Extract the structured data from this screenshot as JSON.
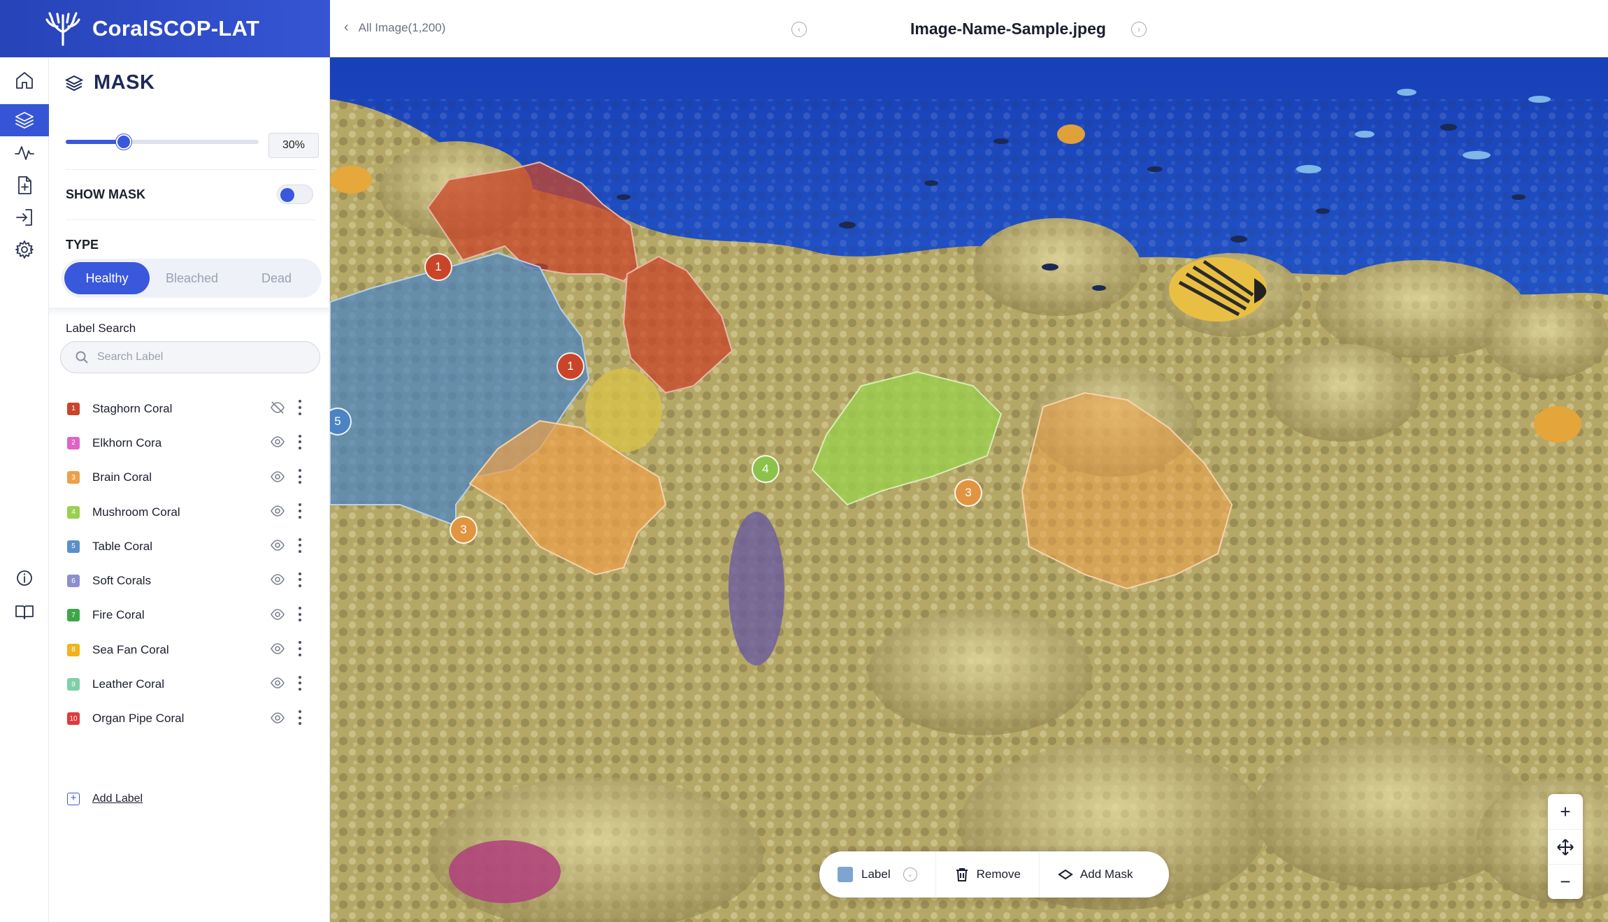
{
  "app": {
    "name": "CoralSCOP-LAT"
  },
  "topbar": {
    "back_label": "All Image(1,200)",
    "image_name": "Image-Name-Sample.jpeg"
  },
  "panel": {
    "title": "MASK",
    "opacity_value": "30%",
    "opacity_fraction": 0.3,
    "show_mask_label": "SHOW MASK",
    "show_mask_on": true,
    "type_label": "TYPE",
    "types": [
      "Healthy",
      "Bleached",
      "Dead"
    ],
    "active_type": "Healthy",
    "label_search_label": "Label Search",
    "search_placeholder": "Search Label",
    "labels": [
      {
        "num": "1",
        "name": "Staghorn Coral",
        "color": "#c9452a",
        "hidden": true
      },
      {
        "num": "2",
        "name": "Elkhorn Cora",
        "color": "#e063c8",
        "hidden": false
      },
      {
        "num": "3",
        "name": "Brain Coral",
        "color": "#eca04a",
        "hidden": false
      },
      {
        "num": "4",
        "name": "Mushroom Coral",
        "color": "#9bd04e",
        "hidden": false
      },
      {
        "num": "5",
        "name": "Table Coral",
        "color": "#5b8fc8",
        "hidden": false
      },
      {
        "num": "6",
        "name": "Soft Corals",
        "color": "#8b8fcf",
        "hidden": false
      },
      {
        "num": "7",
        "name": "Fire Coral",
        "color": "#3fa648",
        "hidden": false
      },
      {
        "num": "8",
        "name": "Sea Fan Coral",
        "color": "#f2b21c",
        "hidden": false
      },
      {
        "num": "9",
        "name": "Leather Coral",
        "color": "#7fcfa7",
        "hidden": false
      },
      {
        "num": "10",
        "name": "Organ Pipe Coral",
        "color": "#e03b3b",
        "hidden": false
      }
    ],
    "add_label": "Add Label"
  },
  "canvas": {
    "markers": [
      "1",
      "1",
      "5",
      "4",
      "3",
      "3"
    ]
  },
  "toolbar": {
    "label": "Label",
    "remove": "Remove",
    "add_mask": "Add Mask"
  },
  "colors": {
    "accent": "#3a58dc",
    "brand": "#2f4dc9"
  },
  "icons": {
    "rail": [
      "home-icon",
      "grid-icon",
      "layers-icon",
      "activity-icon",
      "file-plus-icon",
      "login-icon",
      "gear-icon",
      "info-icon",
      "book-icon"
    ]
  }
}
